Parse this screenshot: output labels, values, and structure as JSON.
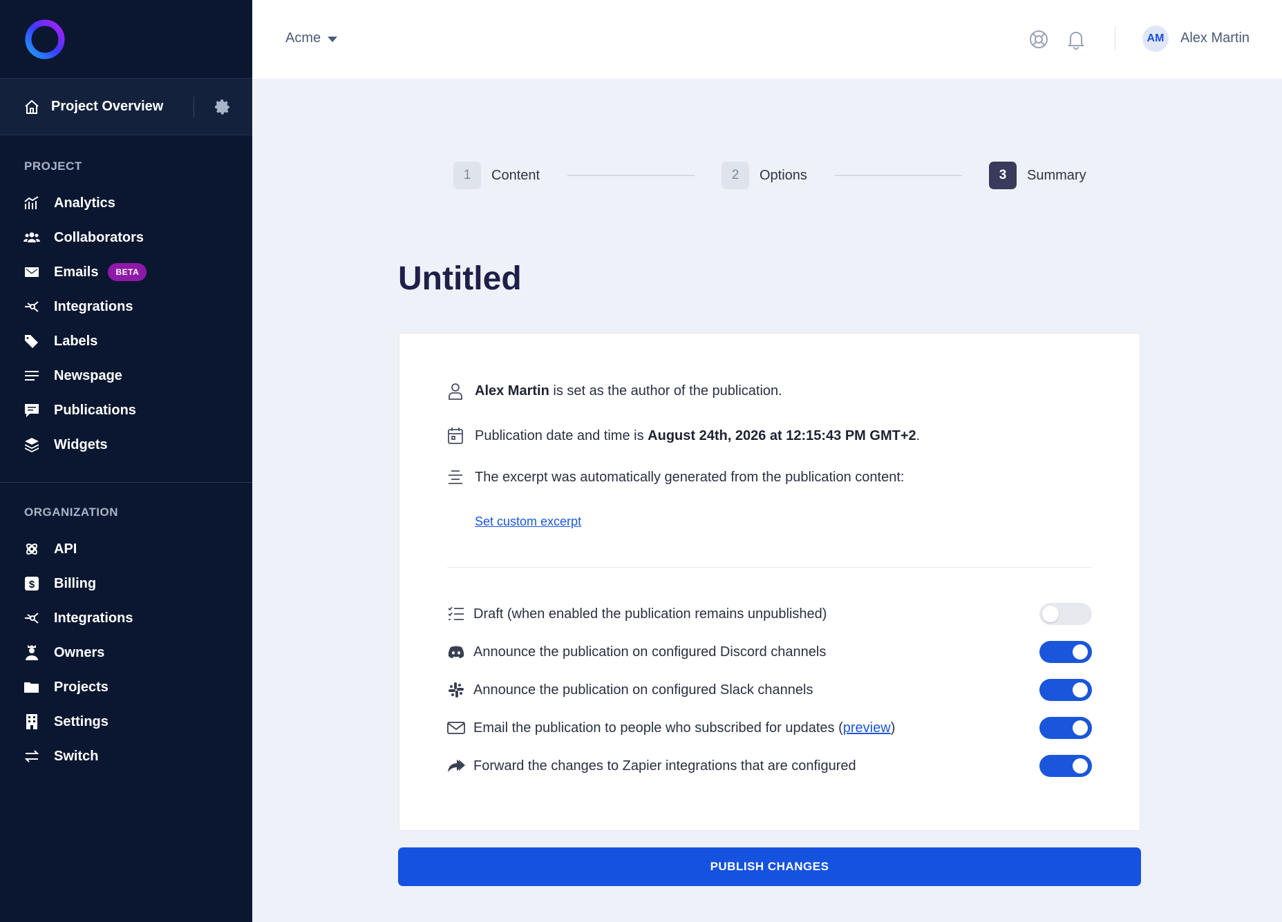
{
  "sidebar": {
    "overview_label": "Project Overview",
    "project_section": "PROJECT",
    "project_items": [
      {
        "label": "Analytics",
        "icon": "analytics-icon"
      },
      {
        "label": "Collaborators",
        "icon": "users-icon"
      },
      {
        "label": "Emails",
        "icon": "email-icon",
        "badge": "BETA"
      },
      {
        "label": "Integrations",
        "icon": "integrations-icon"
      },
      {
        "label": "Labels",
        "icon": "tags-icon"
      },
      {
        "label": "Newspage",
        "icon": "list-icon"
      },
      {
        "label": "Publications",
        "icon": "message-icon"
      },
      {
        "label": "Widgets",
        "icon": "layers-icon"
      }
    ],
    "org_section": "ORGANIZATION",
    "org_items": [
      {
        "label": "API",
        "icon": "api-icon"
      },
      {
        "label": "Billing",
        "icon": "dollar-icon"
      },
      {
        "label": "Integrations",
        "icon": "integrations-icon"
      },
      {
        "label": "Owners",
        "icon": "owner-icon"
      },
      {
        "label": "Projects",
        "icon": "folder-icon"
      },
      {
        "label": "Settings",
        "icon": "building-icon"
      },
      {
        "label": "Switch",
        "icon": "switch-icon"
      }
    ]
  },
  "header": {
    "org_name": "Acme",
    "avatar_initials": "AM",
    "user_name": "Alex Martin"
  },
  "stepper": [
    {
      "num": "1",
      "label": "Content"
    },
    {
      "num": "2",
      "label": "Options"
    },
    {
      "num": "3",
      "label": "Summary"
    }
  ],
  "page_title": "Untitled",
  "summary": {
    "author_name": "Alex Martin",
    "author_suffix": " is set as the author of the publication.",
    "date_prefix": "Publication date and time is ",
    "date_value": "August 24th, 2026 at 12:15:43 PM GMT+2",
    "date_suffix": ".",
    "excerpt_text": "The excerpt was automatically generated from the publication content:",
    "custom_excerpt_link": "Set custom excerpt"
  },
  "toggles": {
    "draft": {
      "label": "Draft (when enabled the publication remains unpublished)",
      "on": false
    },
    "discord": {
      "label": "Announce the publication on configured Discord channels",
      "on": true
    },
    "slack": {
      "label": "Announce the publication on configured Slack channels",
      "on": true
    },
    "email": {
      "label_prefix": "Email the publication to people who subscribed for updates (",
      "link": "preview",
      "label_suffix": ")",
      "on": true
    },
    "zapier": {
      "label": "Forward the changes to Zapier integrations that are configured",
      "on": true
    }
  },
  "publish_label": "PUBLISH CHANGES",
  "colors": {
    "sidebar_bg": "#0b1730",
    "accent": "#1652e0",
    "beta_badge": "#8e1aa7"
  }
}
